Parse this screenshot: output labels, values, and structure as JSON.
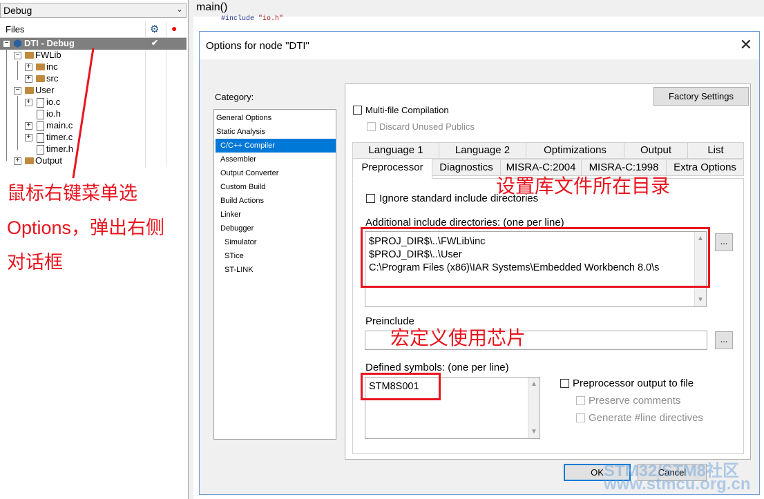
{
  "workspace": {
    "config": "Debug",
    "files_header": "Files",
    "tree": [
      {
        "label": "DTI - Debug"
      },
      {
        "label": "FWLib"
      },
      {
        "label": "inc"
      },
      {
        "label": "src"
      },
      {
        "label": "User"
      },
      {
        "label": "io.c"
      },
      {
        "label": "io.h"
      },
      {
        "label": "main.c"
      },
      {
        "label": "timer.c"
      },
      {
        "label": "timer.h"
      },
      {
        "label": "Output"
      }
    ]
  },
  "annotation_left": [
    "鼠标右键菜单选",
    "Options，弹出右侧",
    "对话框"
  ],
  "editor": {
    "title": "main()",
    "code_prefix": "#include ",
    "code_str": "\"io.h\""
  },
  "dialog": {
    "title": "Options for node \"DTI\"",
    "category_label": "Category:",
    "categories": [
      "General Options",
      "Static Analysis",
      "C/C++ Compiler",
      "Assembler",
      "Output Converter",
      "Custom Build",
      "Build Actions",
      "Linker",
      "Debugger",
      "Simulator",
      "STice",
      "ST-LINK"
    ],
    "selected_category": "C/C++ Compiler",
    "factory_settings": "Factory Settings",
    "multi_file": "Multi-file Compilation",
    "discard_unused": "Discard Unused Publics",
    "tabs_row1": [
      "Language 1",
      "Language 2",
      "Optimizations",
      "Output",
      "List"
    ],
    "tabs_row2": [
      "Preprocessor",
      "Diagnostics",
      "MISRA-C:2004",
      "MISRA-C:1998",
      "Extra Options"
    ],
    "active_tab": "Preprocessor",
    "ignore_std": "Ignore standard include directories",
    "include_label": "Additional include directories: (one per line)",
    "include_dirs": [
      "$PROJ_DIR$\\..\\FWLib\\inc",
      "$PROJ_DIR$\\..\\User",
      "C:\\Program Files (x86)\\IAR Systems\\Embedded Workbench 8.0\\s"
    ],
    "browse": "...",
    "preinclude_label": "Preinclude",
    "preinclude_value": "",
    "defined_label": "Defined symbols: (one per line)",
    "defined_symbols": [
      "STM8S001"
    ],
    "pp_output": "Preprocessor output to file",
    "preserve_comments": "Preserve comments",
    "gen_line": "Generate #line directives",
    "ok": "OK",
    "cancel": "Cancel"
  },
  "annotations": {
    "include_note": "设置库文件所在目录",
    "define_note": "宏定义使用芯片"
  },
  "watermark": {
    "line1": "STM32/STM8社区",
    "line2": "www.stmcu.org.cn"
  },
  "colors": {
    "annotation": "#e8141e",
    "selection": "#0078d7"
  }
}
